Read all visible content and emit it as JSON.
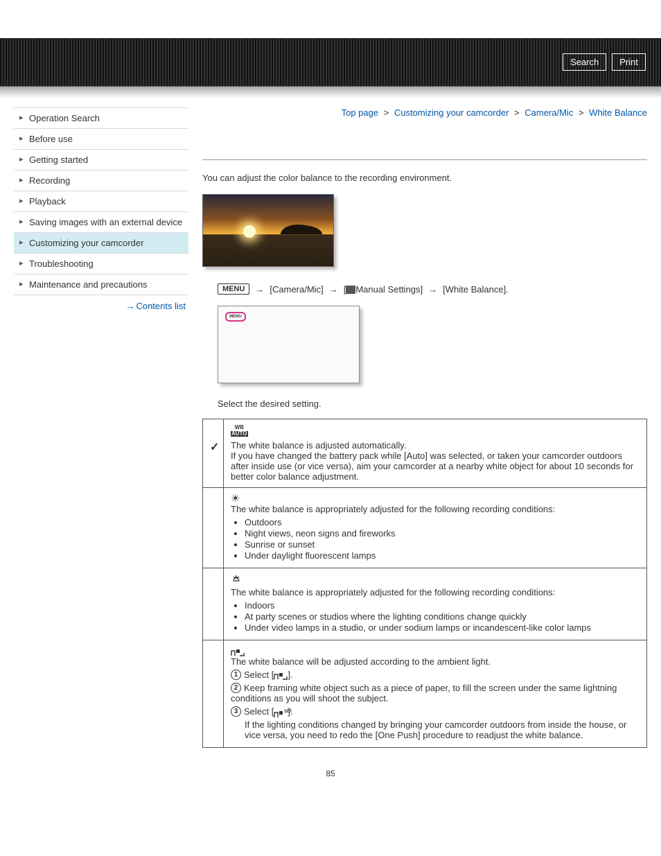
{
  "header": {
    "search_label": "Search",
    "print_label": "Print"
  },
  "breadcrumb": {
    "items": [
      "Top page",
      "Customizing your camcorder",
      "Camera/Mic",
      "White Balance"
    ],
    "sep": ">"
  },
  "sidebar": {
    "items": [
      {
        "label": "Operation Search"
      },
      {
        "label": "Before use"
      },
      {
        "label": "Getting started"
      },
      {
        "label": "Recording"
      },
      {
        "label": "Playback"
      },
      {
        "label": "Saving images with an external device"
      },
      {
        "label": "Customizing your camcorder",
        "active": true
      },
      {
        "label": "Troubleshooting"
      },
      {
        "label": "Maintenance and precautions"
      }
    ],
    "contents_link": "Contents list"
  },
  "content": {
    "intro": "You can adjust the color balance to the recording environment.",
    "menu_label": "MENU",
    "path_segments": {
      "seg1": "[Camera/Mic]",
      "seg2_prefix": "[",
      "seg2_text": "Manual Settings]",
      "seg3": "[White Balance]."
    },
    "screen_menu_label": "MENU",
    "step2": "Select the desired setting.",
    "rows": {
      "auto": {
        "icon": {
          "top": "WB",
          "bottom": "AUTO"
        },
        "line1": "The white balance is adjusted automatically.",
        "line2": "If you have changed the battery pack while [Auto] was selected, or taken your camcorder outdoors after inside use (or vice versa), aim your camcorder at a nearby white object for about 10 seconds for better color balance adjustment."
      },
      "outdoor": {
        "lead": "The white balance is appropriately adjusted for the following recording conditions:",
        "items": [
          "Outdoors",
          "Night views, neon signs and fireworks",
          "Sunrise or sunset",
          "Under daylight fluorescent lamps"
        ]
      },
      "indoor": {
        "lead": "The white balance is appropriately adjusted for the following recording conditions:",
        "items": [
          "Indoors",
          "At party scenes or studios where the lighting conditions change quickly",
          "Under video lamps in a studio, or under sodium lamps or incandescent-like color lamps"
        ]
      },
      "onepush": {
        "lead": "The white balance will be adjusted according to the ambient light.",
        "step1_pre": "Select [",
        "step1_post": "].",
        "step2": "Keep framing white object such as a piece of paper, to fill the screen under the same lightning conditions as you will shoot the subject.",
        "step3_pre": "Select [",
        "step3_set": "SET",
        "step3_post": "].",
        "step3_sub": "If the lighting conditions changed by bringing your camcorder outdoors from inside the house, or vice versa, you need to redo the [One Push] procedure to readjust the white balance."
      }
    },
    "checkmark": "✓"
  },
  "page_number": "85"
}
